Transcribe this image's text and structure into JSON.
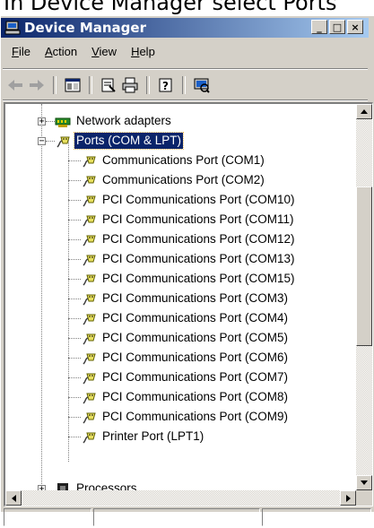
{
  "caption": {
    "text": "In Device Manager select Ports"
  },
  "window": {
    "title": "Device Manager",
    "buttons": {
      "minimize": "_",
      "maximize": "□",
      "close": "×"
    }
  },
  "menu": [
    {
      "underline": "F",
      "rest": "ile"
    },
    {
      "underline": "A",
      "rest": "ction"
    },
    {
      "underline": "V",
      "rest": "iew"
    },
    {
      "underline": "H",
      "rest": "elp"
    }
  ],
  "toolbar": {
    "icons": [
      "back-icon",
      "forward-icon",
      "show-hide-console-tree-icon",
      "properties-icon",
      "print-icon",
      "help-icon",
      "scan-hardware-icon"
    ]
  },
  "tree": {
    "network": "Network adapters",
    "ports": "Ports (COM & LPT)",
    "children": [
      "Communications Port (COM1)",
      "Communications Port (COM2)",
      "PCI Communications Port (COM10)",
      "PCI Communications Port (COM11)",
      "PCI Communications Port (COM12)",
      "PCI Communications Port (COM13)",
      "PCI Communications Port (COM15)",
      "PCI Communications Port (COM3)",
      "PCI Communications Port (COM4)",
      "PCI Communications Port (COM5)",
      "PCI Communications Port (COM6)",
      "PCI Communications Port (COM7)",
      "PCI Communications Port (COM8)",
      "PCI Communications Port (COM9)",
      "Printer Port (LPT1)"
    ],
    "processors": "Processors"
  },
  "colors": {
    "titlebar_start": "#0a246a",
    "titlebar_end": "#a6caf0",
    "selection": "#0a246a",
    "chrome": "#d4d0c8"
  },
  "statusbar": [
    "",
    "",
    ""
  ]
}
